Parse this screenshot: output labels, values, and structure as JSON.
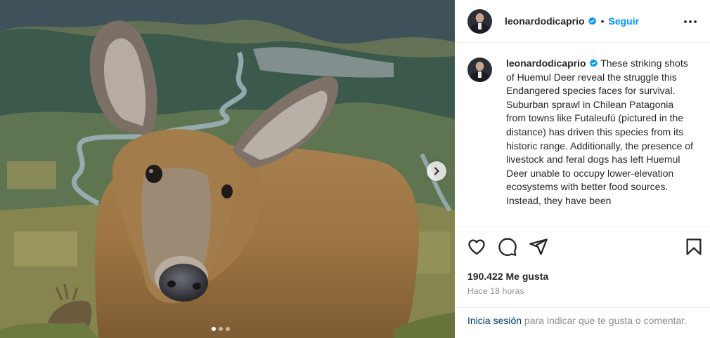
{
  "post": {
    "username": "leonardodicaprio",
    "separator": "•",
    "follow_label": "Seguir",
    "caption_text": "These striking shots of Huemul Deer reveal the struggle this Endangered species faces for survival. Suburban sprawl in Chilean Patagonia from towns like Futaleufú (pictured in the distance) has driven this species from its historic range. Additionally, the presence of livestock and feral dogs has left Huemul Deer unable to occupy lower-elevation ecosystems with better food sources. Instead, they have been",
    "likes": "190.422 Me gusta",
    "time_ago": "Hace 18 horas",
    "login_link": "Inicia sesión",
    "login_prompt": " para indicar que te gusta o comentar."
  },
  "carousel": {
    "slide_count": 3,
    "active_slide": 1
  },
  "colors": {
    "link_blue": "#0095f6",
    "verified_blue": "#0095f6",
    "text": "#262626",
    "muted": "#8e8e8e",
    "login_link": "#00376b"
  },
  "icons": {
    "next": "chevron-right-icon",
    "more": "more-horizontal-icon",
    "verified": "verified-badge-icon",
    "like": "heart-icon",
    "comment": "comment-icon",
    "share": "share-icon",
    "save": "bookmark-icon"
  }
}
